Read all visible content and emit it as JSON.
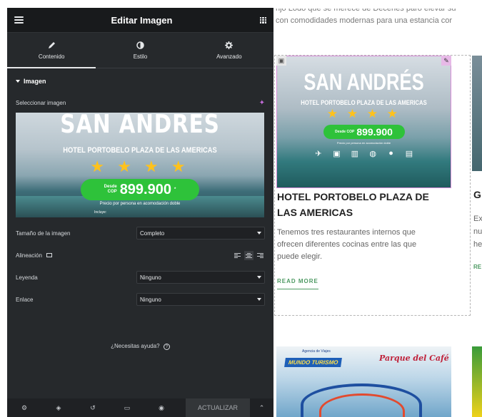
{
  "panel": {
    "title": "Editar Imagen",
    "tabs": [
      {
        "label": "Contenido",
        "icon": "pencil-icon",
        "active": true
      },
      {
        "label": "Estilo",
        "icon": "contrast-icon",
        "active": false
      },
      {
        "label": "Avanzado",
        "icon": "gear-icon",
        "active": false
      }
    ],
    "section_title": "Imagen",
    "select_image_label": "Seleccionar imagen",
    "image_preview": {
      "title": "SAN ANDRES",
      "subtitle": "HOTEL PORTOBELO PLAZA DE LAS AMERICAS",
      "stars": "★ ★ ★ ★",
      "price_prefix_1": "Desde",
      "price_prefix_2": "COP",
      "price": "899.900",
      "price_suffix": "*",
      "per_person": "Precio por persona en acomodación doble",
      "includes": "Incluye:"
    },
    "controls": {
      "image_size_label": "Tamaño de la imagen",
      "image_size_value": "Completo",
      "alignment_label": "Alineación",
      "caption_label": "Leyenda",
      "caption_value": "Ninguno",
      "link_label": "Enlace",
      "link_value": "Ninguno"
    },
    "help_text": "¿Necesitas ayuda?",
    "help_icon": "?",
    "update_label": "ACTUALIZAR"
  },
  "preview": {
    "intro_line1": "rijo Lodo que se merece de Decenes paro elevar su",
    "intro_line2": "con comodidades modernas para una estancia cor",
    "card1": {
      "image": {
        "title": "SAN ANDRÉS",
        "subtitle": "HOTEL PORTOBELO PLAZA DE LAS AMERICAS",
        "stars": "★ ★ ★ ★",
        "price_prefix": "Desde COP",
        "price": "899.900",
        "per_person": "Precio por persona en acomodación doble"
      },
      "title": "HOTEL PORTOBELO PLAZA DE LAS AMERICAS",
      "text": "Tenemos tres restaurantes internos que ofrecen diferentes cocinas entre las que puede elegir.",
      "link": "READ MORE"
    },
    "card2": {
      "title": "G",
      "text_lines": [
        "Ex",
        "nu",
        "he"
      ],
      "link": "RE"
    },
    "card3": {
      "agency": "Agencia de Viajes",
      "brand": "MUNDO TURISMO",
      "park": "Parque del Café"
    }
  },
  "colors": {
    "panel_bg": "#26292c",
    "header_bg": "#181a1c",
    "accent_green": "#4e9a63",
    "selection_pink": "#d98dd9",
    "ai_purple": "#c56ddc"
  }
}
